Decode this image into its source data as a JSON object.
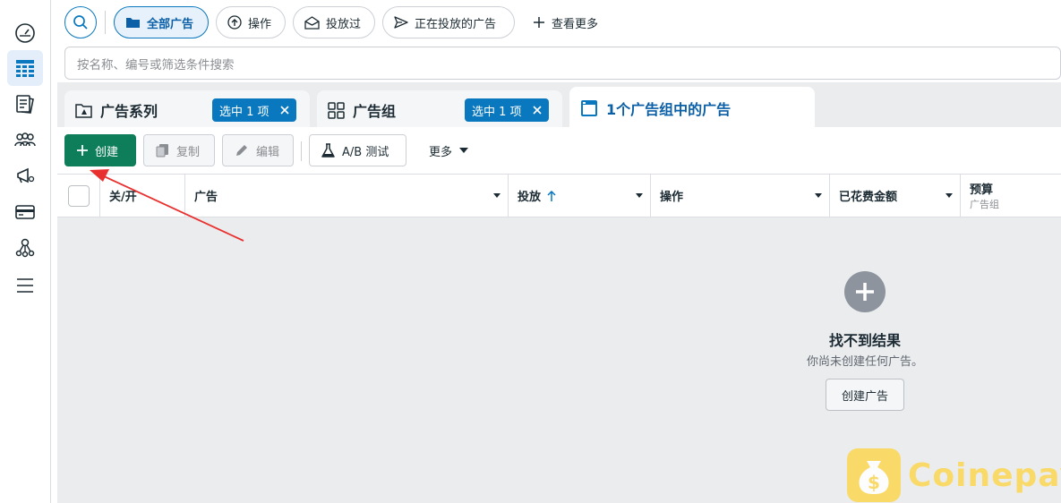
{
  "filters": {
    "all_ads": "全部广告",
    "actions": "操作",
    "delivered": "投放过",
    "active_ads": "正在投放的广告",
    "see_more": "查看更多"
  },
  "search": {
    "placeholder": "按名称、编号或筛选条件搜索"
  },
  "levels": {
    "campaigns": "广告系列",
    "adsets": "广告组",
    "ads": "1个广告组中的广告",
    "selected_badge": "选中 1 项"
  },
  "toolbar": {
    "create": "创建",
    "duplicate": "复制",
    "edit": "编辑",
    "ab_test": "A/B 测试",
    "more": "更多"
  },
  "columns": {
    "toggle": "关/开",
    "ad": "广告",
    "delivery": "投放",
    "actions": "操作",
    "amount_spent": "已花费金额",
    "budget": "预算",
    "budget_sub": "广告组"
  },
  "empty_state": {
    "title": "找不到结果",
    "subtitle": "你尚未创建任何广告。",
    "button": "创建广告"
  },
  "watermark": {
    "text": "Coinepay"
  },
  "colors": {
    "accent": "#0a78be",
    "create_green": "#0e7d59",
    "annotation_red": "#e8312f",
    "watermark": "#fbd75a"
  }
}
